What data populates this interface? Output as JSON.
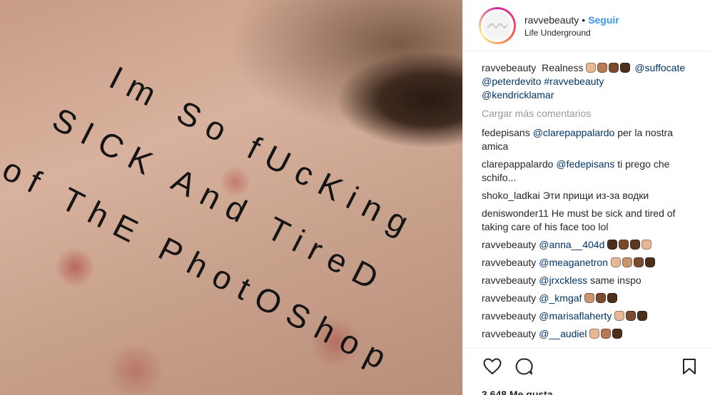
{
  "post": {
    "username": "ravvebeauty",
    "separator": "•",
    "follow_label": "Seguir",
    "location": "Life Underground"
  },
  "photo": {
    "sticker_lines": [
      "Im So fUcKing",
      "SICK And TireD",
      "of ThE PhotOShop"
    ]
  },
  "caption": {
    "username": "ravvebeauty",
    "text": "Realness",
    "emojis": [
      "#e7b895",
      "#b97852",
      "#7a4b2e",
      "#4d2f1d"
    ],
    "mentions": [
      "@suffocate",
      "@peterdevito",
      "#ravvebeauty",
      "@kendricklamar"
    ]
  },
  "load_more_label": "Cargar más comentarios",
  "comments": [
    {
      "username": "fedepisans",
      "mention": "@clarepappalardo",
      "text": "per la nostra amica",
      "emojis": []
    },
    {
      "username": "clarepappalardo",
      "mention": "@fedepisans",
      "text": "ti prego che schifo...",
      "emojis": []
    },
    {
      "username": "shoko_ladkai",
      "mention": "",
      "text": "Эти прищи из-за водки",
      "emojis": []
    },
    {
      "username": "deniswonder11",
      "mention": "",
      "text": "He must be sick and tired of taking care of his face too lol",
      "emojis": []
    },
    {
      "username": "ravvebeauty",
      "mention": "@anna__404d",
      "text": "",
      "emojis": [
        "#4d2f1d",
        "#7a4b2e",
        "#5a3a25",
        "#e7b895"
      ]
    },
    {
      "username": "ravvebeauty",
      "mention": "@meaganetron",
      "text": "",
      "emojis": [
        "#e7b895",
        "#c99570",
        "#7a4b2e",
        "#4d2f1d"
      ]
    },
    {
      "username": "ravvebeauty",
      "mention": "@jrxckless",
      "text": "same inspo",
      "emojis": []
    },
    {
      "username": "ravvebeauty",
      "mention": "@_kmgaf",
      "text": "",
      "emojis": [
        "#c99570",
        "#7a4b2e",
        "#4d2f1d"
      ]
    },
    {
      "username": "ravvebeauty",
      "mention": "@marisaflaherty",
      "text": "",
      "emojis": [
        "#e7b895",
        "#7a4b2e",
        "#4d2f1d"
      ]
    },
    {
      "username": "ravvebeauty",
      "mention": "@__audiel",
      "text": "",
      "emojis": [
        "#e7b895",
        "#b97852",
        "#4d2f1d"
      ]
    }
  ],
  "actions": {
    "like_icon": "heart-icon",
    "comment_icon": "speech-bubble-icon",
    "save_icon": "bookmark-icon",
    "likes_text": "3.648 Me gusta"
  }
}
